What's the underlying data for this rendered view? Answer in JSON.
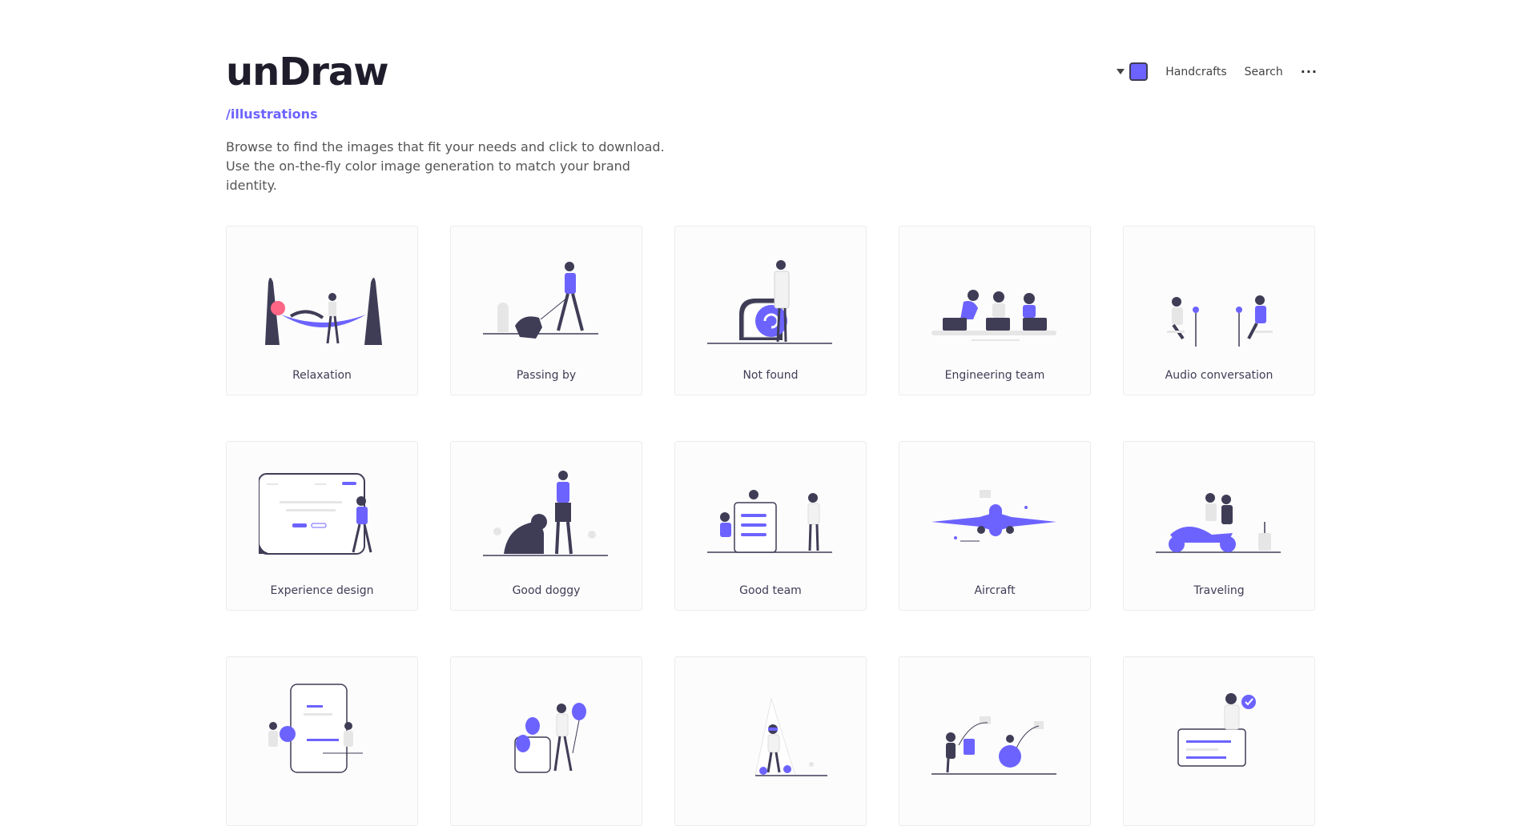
{
  "header": {
    "logo": "unDraw",
    "subnav": "/illustrations",
    "intro": "Browse to find the images that fit your needs and click to download. Use the on-the-fly color image generation to match your brand identity.",
    "accent_color": "#6c63ff"
  },
  "nav": {
    "color_picker_icon": "caret-down-icon",
    "handcrafts": "Handcrafts",
    "search": "Search",
    "more": "···"
  },
  "illustrations": [
    {
      "title": "Relaxation"
    },
    {
      "title": "Passing by"
    },
    {
      "title": "Not found"
    },
    {
      "title": "Engineering team"
    },
    {
      "title": "Audio conversation"
    },
    {
      "title": "Experience design"
    },
    {
      "title": "Good doggy"
    },
    {
      "title": "Good team"
    },
    {
      "title": "Aircraft"
    },
    {
      "title": "Traveling"
    },
    {
      "title": ""
    },
    {
      "title": ""
    },
    {
      "title": ""
    },
    {
      "title": ""
    },
    {
      "title": ""
    }
  ]
}
